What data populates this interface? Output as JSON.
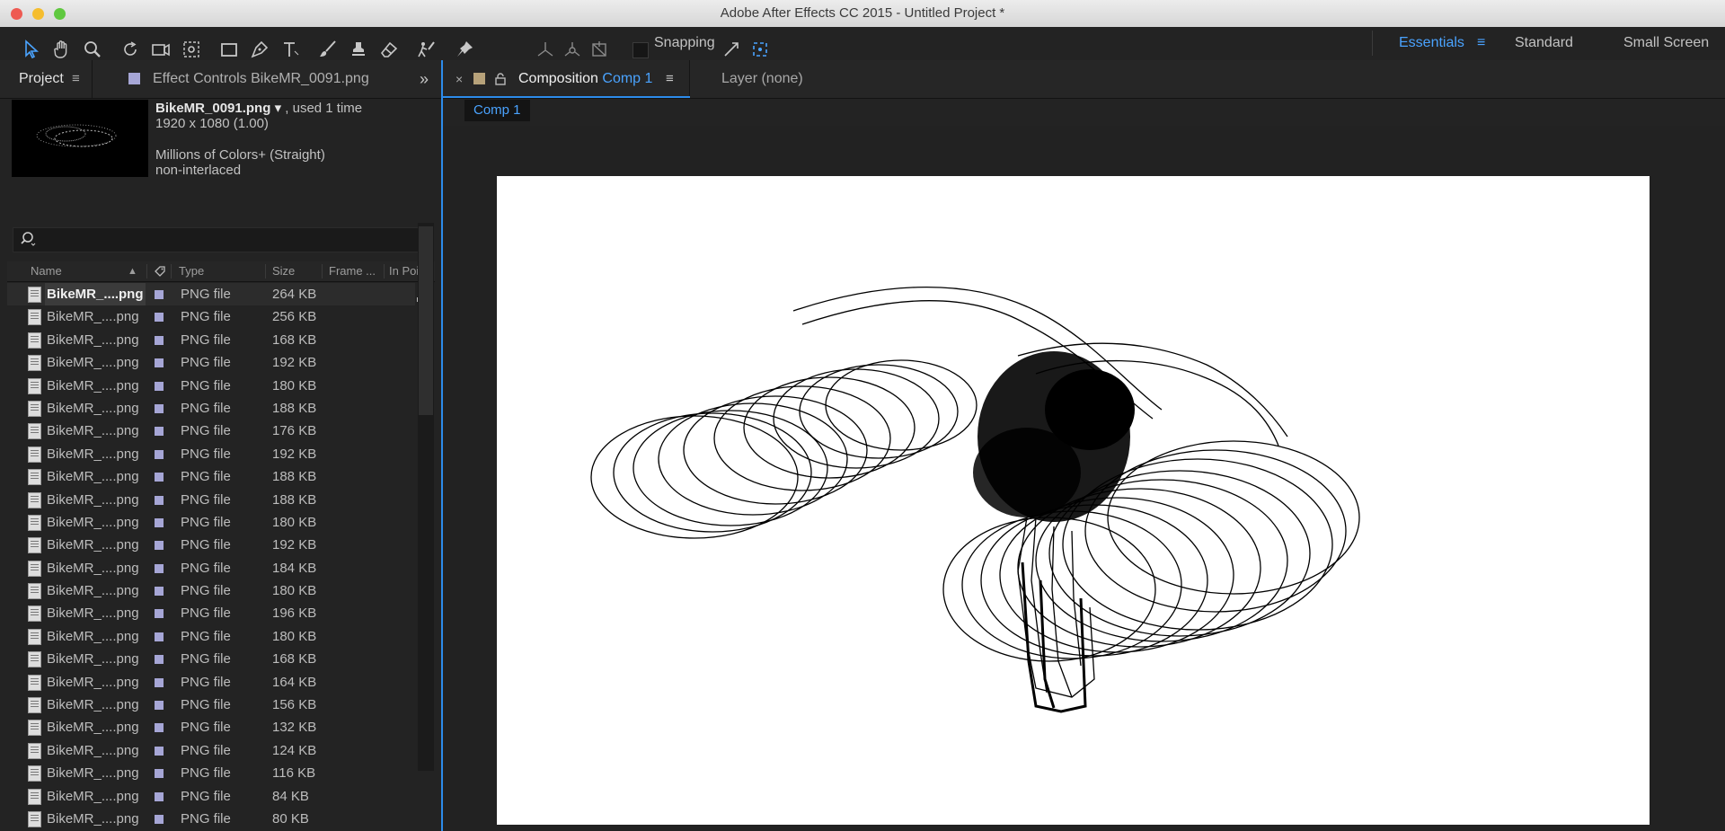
{
  "window": {
    "title": "Adobe After Effects CC 2015 - Untitled Project *",
    "traffic_lights": [
      "#ee5a52",
      "#f5bd2e",
      "#5fc83f"
    ]
  },
  "toolbar": {
    "snapping_label": "Snapping",
    "tools": [
      "selection-tool",
      "hand-tool",
      "zoom-tool",
      "rotation-tool",
      "camera-tool",
      "pan-behind-tool",
      "rectangle-tool",
      "pen-tool",
      "type-tool",
      "brush-tool",
      "clone-stamp-tool",
      "eraser-tool",
      "roto-brush-tool",
      "puppet-pin-tool"
    ],
    "workspaces": [
      {
        "label": "Essentials",
        "active": true
      },
      {
        "label": "Standard",
        "active": false
      },
      {
        "label": "Small Screen",
        "active": false
      }
    ]
  },
  "project_panel": {
    "tab_project": "Project",
    "tab_effect_controls": "Effect Controls BikeMR_0091.png",
    "info": {
      "filename": "BikeMR_0091.png",
      "used": ", used 1 time",
      "dimensions": "1920 x 1080 (1.00)",
      "color": "Millions of Colors+ (Straight)",
      "interlace": "non-interlaced"
    },
    "search_placeholder": "",
    "columns": {
      "name": "Name",
      "type": "Type",
      "size": "Size",
      "frame": "Frame ...",
      "in_point": "In Point"
    },
    "rows": [
      {
        "name": "BikeMR_....png",
        "type": "PNG file",
        "size": "264 KB",
        "selected": true
      },
      {
        "name": "BikeMR_....png",
        "type": "PNG file",
        "size": "256 KB"
      },
      {
        "name": "BikeMR_....png",
        "type": "PNG file",
        "size": "168 KB"
      },
      {
        "name": "BikeMR_....png",
        "type": "PNG file",
        "size": "192 KB"
      },
      {
        "name": "BikeMR_....png",
        "type": "PNG file",
        "size": "180 KB"
      },
      {
        "name": "BikeMR_....png",
        "type": "PNG file",
        "size": "188 KB"
      },
      {
        "name": "BikeMR_....png",
        "type": "PNG file",
        "size": "176 KB"
      },
      {
        "name": "BikeMR_....png",
        "type": "PNG file",
        "size": "192 KB"
      },
      {
        "name": "BikeMR_....png",
        "type": "PNG file",
        "size": "188 KB"
      },
      {
        "name": "BikeMR_....png",
        "type": "PNG file",
        "size": "188 KB"
      },
      {
        "name": "BikeMR_....png",
        "type": "PNG file",
        "size": "180 KB"
      },
      {
        "name": "BikeMR_....png",
        "type": "PNG file",
        "size": "192 KB"
      },
      {
        "name": "BikeMR_....png",
        "type": "PNG file",
        "size": "184 KB"
      },
      {
        "name": "BikeMR_....png",
        "type": "PNG file",
        "size": "180 KB"
      },
      {
        "name": "BikeMR_....png",
        "type": "PNG file",
        "size": "196 KB"
      },
      {
        "name": "BikeMR_....png",
        "type": "PNG file",
        "size": "180 KB"
      },
      {
        "name": "BikeMR_....png",
        "type": "PNG file",
        "size": "168 KB"
      },
      {
        "name": "BikeMR_....png",
        "type": "PNG file",
        "size": "164 KB"
      },
      {
        "name": "BikeMR_....png",
        "type": "PNG file",
        "size": "156 KB"
      },
      {
        "name": "BikeMR_....png",
        "type": "PNG file",
        "size": "132 KB"
      },
      {
        "name": "BikeMR_....png",
        "type": "PNG file",
        "size": "124 KB"
      },
      {
        "name": "BikeMR_....png",
        "type": "PNG file",
        "size": "116 KB"
      },
      {
        "name": "BikeMR_....png",
        "type": "PNG file",
        "size": "84 KB"
      },
      {
        "name": "BikeMR_....png",
        "type": "PNG file",
        "size": "80 KB"
      }
    ]
  },
  "comp_panel": {
    "tab_prefix": "Composition",
    "tab_name": "Comp 1",
    "layer_tab": "Layer (none)",
    "breadcrumb": "Comp 1",
    "accent": "#2d8ceb"
  }
}
